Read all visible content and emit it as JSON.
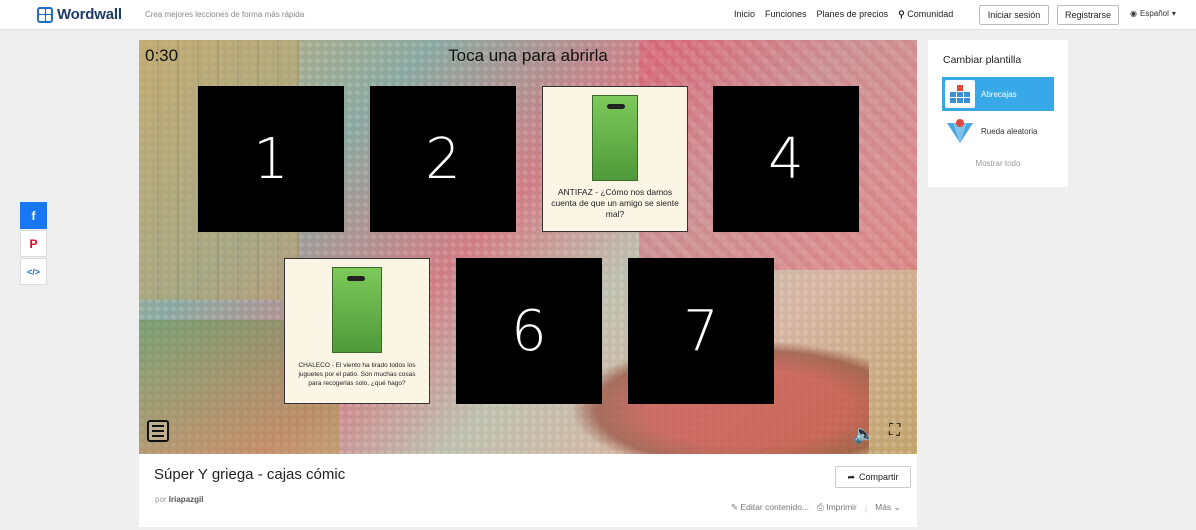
{
  "header": {
    "brand": "Wordwall",
    "tagline": "Crea mejores lecciones de forma más rápida",
    "nav": [
      "Inicio",
      "Funciones",
      "Planes de precios",
      "Comunidad"
    ],
    "login_label": "Iniciar sesión",
    "register_label": "Registrarse",
    "language": "Español"
  },
  "share_sidebar": {
    "facebook": "f",
    "pinterest": "P",
    "embed": "</>"
  },
  "game": {
    "timer": "0:30",
    "prompt": "Toca una para abrirla",
    "boxes": [
      {
        "label": "1",
        "opened": false
      },
      {
        "label": "2",
        "opened": false
      },
      {
        "label": "ANTIFAZ - ¿Cómo nos damos cuenta de que un amigo se siente mal?",
        "opened": true
      },
      {
        "label": "4",
        "opened": false
      },
      {
        "label": "CHALECO - El viento ha tirado todos los juguetes por el patio. Son muchas cosas para recogerlas solo, ¿qué hago?",
        "opened": true
      },
      {
        "label": "6",
        "opened": false
      },
      {
        "label": "7",
        "opened": false
      }
    ]
  },
  "activity": {
    "title": "Súper Y griega - cajas cómic",
    "by_prefix": "por",
    "author": "Iriapazgil",
    "share_label": "Compartir",
    "edit_label": "Editar contenido...",
    "print_label": "Imprimir",
    "more_label": "Más"
  },
  "templates": {
    "title": "Cambiar plantilla",
    "items": [
      {
        "label": "Abrecajas",
        "active": true
      },
      {
        "label": "Rueda aleatoria",
        "active": false
      }
    ],
    "show_all": "Mostrar todo"
  },
  "colors": {
    "brand": "#1f6ec8",
    "facebook": "#1877f2",
    "pinterest": "#e60023",
    "active_template": "#38a8e8"
  }
}
